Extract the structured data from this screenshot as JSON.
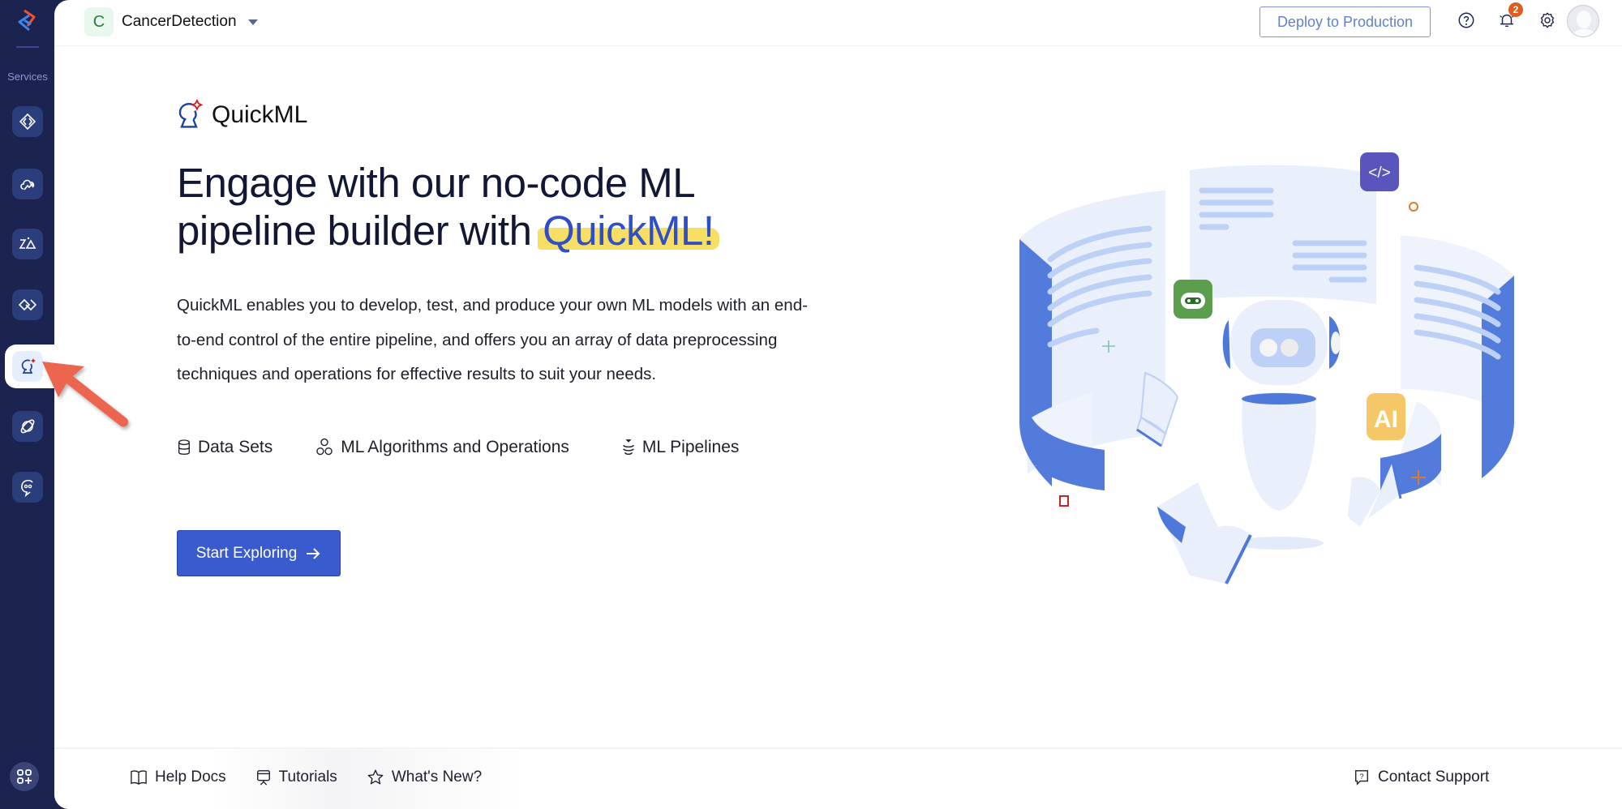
{
  "sidebar": {
    "services_label": "Services",
    "items": [
      {
        "name": "functions",
        "icon": "code-brackets-icon"
      },
      {
        "name": "cloud-scale",
        "icon": "cloud-icon"
      },
      {
        "name": "zia-services",
        "icon": "zia-icon"
      },
      {
        "name": "integrations",
        "icon": "diamond-link-icon"
      },
      {
        "name": "quickml",
        "icon": "quickml-icon",
        "active": true
      },
      {
        "name": "smartbrowz",
        "icon": "planet-icon"
      },
      {
        "name": "conversational-ai",
        "icon": "chatbot-icon"
      }
    ],
    "apps_icon": "apps-add-icon"
  },
  "header": {
    "project_initial": "C",
    "project_name": "CancerDetection",
    "deploy_label": "Deploy to Production",
    "notification_count": "2"
  },
  "main": {
    "brand_name": "QuickML",
    "headline_line1": "Engage with our no-code ML",
    "headline_line2": "pipeline builder with ",
    "headline_highlight": "QuickML!",
    "description": "QuickML enables you to develop, test, and produce your own ML models with an end-to-end control of the entire pipeline, and offers you an array of data preprocessing techniques and operations for effective results to suit your needs.",
    "features": [
      {
        "label": "Data Sets",
        "icon": "database-icon"
      },
      {
        "label": "ML Algorithms and Operations",
        "icon": "hexagons-icon"
      },
      {
        "label": "ML Pipelines",
        "icon": "pipeline-icon"
      }
    ],
    "cta_label": "Start Exploring",
    "illustration_badges": [
      "</>",
      "AI"
    ]
  },
  "footer": {
    "links": [
      {
        "label": "Help Docs",
        "icon": "book-icon"
      },
      {
        "label": "Tutorials",
        "icon": "presentation-icon"
      },
      {
        "label": "What's New?",
        "icon": "star-icon"
      }
    ],
    "contact_label": "Contact Support"
  },
  "colors": {
    "sidebar_bg": "#1b2350",
    "primary": "#3a5bcd",
    "highlight": "#f6d84a",
    "badge": "#e05d1f",
    "annotation_arrow": "#ec6550"
  }
}
